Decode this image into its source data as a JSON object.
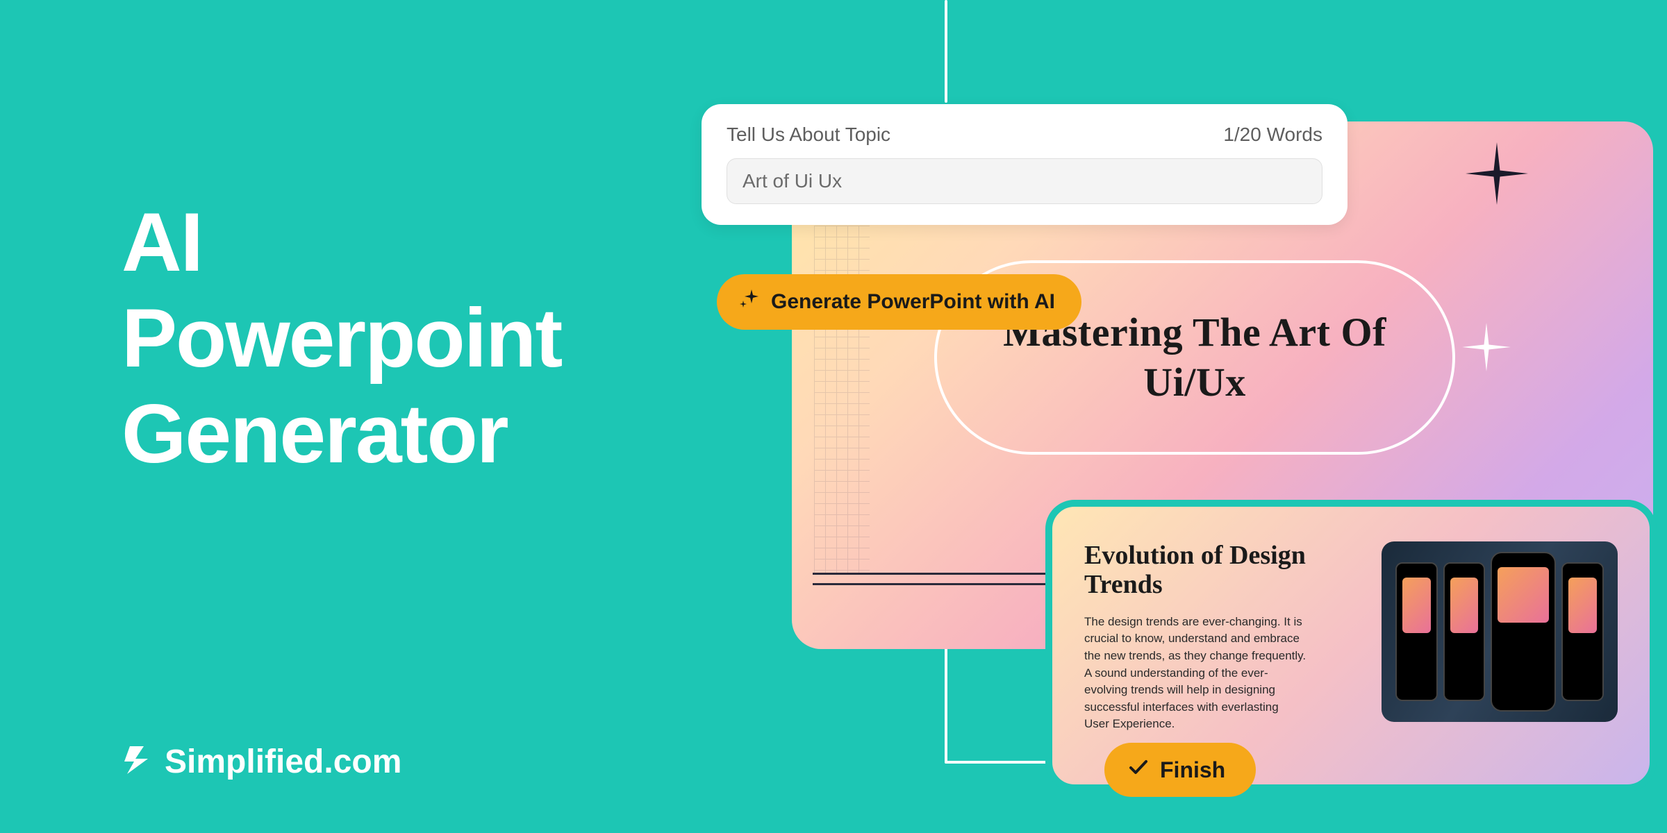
{
  "headline": "AI\nPowerpoint\nGenerator",
  "brand": "Simplified.com",
  "topic_card": {
    "label": "Tell Us About Topic",
    "counter": "1/20 Words",
    "value": "Art of Ui Ux"
  },
  "generate_button": "Generate PowerPoint with AI",
  "finish_button": "Finish",
  "slide_main": {
    "title": "Mastering The Art Of Ui/Ux"
  },
  "slide_small": {
    "title": "Evolution of Design Trends",
    "body": "The design trends are ever-changing. It is crucial to know, understand and embrace the new trends, as they change frequently. A sound understanding of the ever-evolving trends will help in designing successful interfaces with everlasting User Experience."
  },
  "colors": {
    "bg": "#1DC6B4",
    "accent": "#F6A81A"
  }
}
